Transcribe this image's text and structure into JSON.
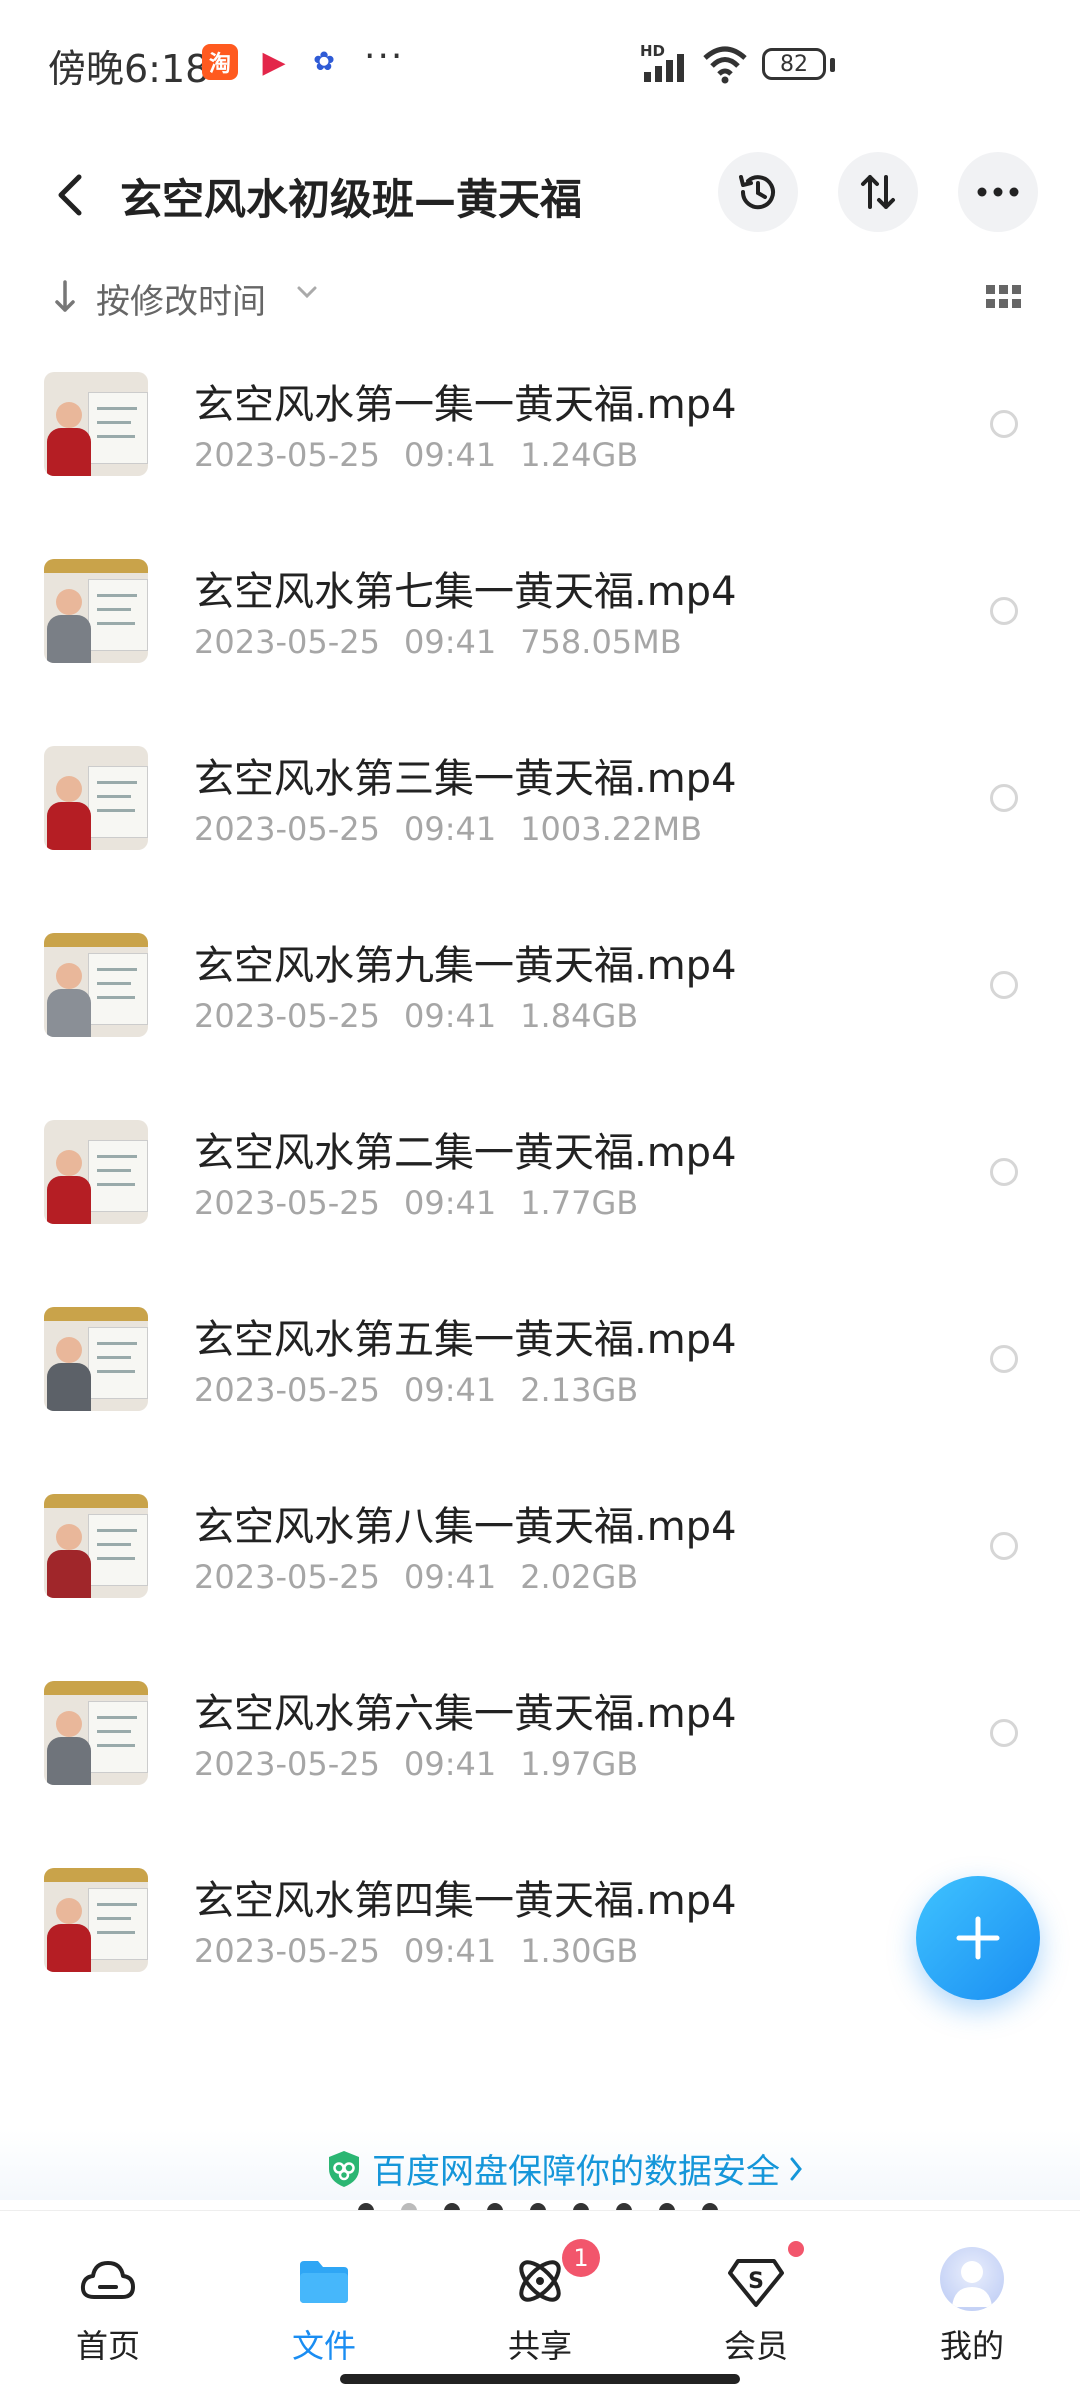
{
  "status_bar": {
    "time": "傍晚6:18",
    "app_icons": [
      "taobao-icon",
      "video-app-icon",
      "baidu-icon"
    ],
    "more": "···",
    "network": "HD",
    "battery": "82"
  },
  "header": {
    "title": "玄空风水初级班—黄天福",
    "buttons": [
      "history-icon",
      "sort-icon",
      "more-icon"
    ]
  },
  "sort": {
    "label": "按修改时间"
  },
  "files": [
    {
      "name": "玄空风水第一集一黄天福.mp4",
      "date": "2023-05-25",
      "time": "09:41",
      "size": "1.24GB"
    },
    {
      "name": "玄空风水第七集一黄天福.mp4",
      "date": "2023-05-25",
      "time": "09:41",
      "size": "758.05MB"
    },
    {
      "name": "玄空风水第三集一黄天福.mp4",
      "date": "2023-05-25",
      "time": "09:41",
      "size": "1003.22MB"
    },
    {
      "name": "玄空风水第九集一黄天福.mp4",
      "date": "2023-05-25",
      "time": "09:41",
      "size": "1.84GB"
    },
    {
      "name": "玄空风水第二集一黄天福.mp4",
      "date": "2023-05-25",
      "time": "09:41",
      "size": "1.77GB"
    },
    {
      "name": "玄空风水第五集一黄天福.mp4",
      "date": "2023-05-25",
      "time": "09:41",
      "size": "2.13GB"
    },
    {
      "name": "玄空风水第八集一黄天福.mp4",
      "date": "2023-05-25",
      "time": "09:41",
      "size": "2.02GB"
    },
    {
      "name": "玄空风水第六集一黄天福.mp4",
      "date": "2023-05-25",
      "time": "09:41",
      "size": "1.97GB"
    },
    {
      "name": "玄空风水第四集一黄天福.mp4",
      "date": "2023-05-25",
      "time": "09:41",
      "size": "1.30GB"
    }
  ],
  "security_banner": {
    "text": "百度网盘保障你的数据安全"
  },
  "page_indicator": {
    "count": 9,
    "active_index": 1
  },
  "tabbar": {
    "items": [
      {
        "label": "首页",
        "icon": "cloud-icon"
      },
      {
        "label": "文件",
        "icon": "folder-icon",
        "active": true
      },
      {
        "label": "共享",
        "icon": "share-orbit-icon",
        "badge": "1"
      },
      {
        "label": "会员",
        "icon": "vip-diamond-icon"
      },
      {
        "label": "我的",
        "icon": "avatar"
      }
    ]
  },
  "colors": {
    "accent": "#1a8df2",
    "meta_text": "#a6a6a6",
    "badge": "#f2566c",
    "security_text": "#1596d9"
  }
}
